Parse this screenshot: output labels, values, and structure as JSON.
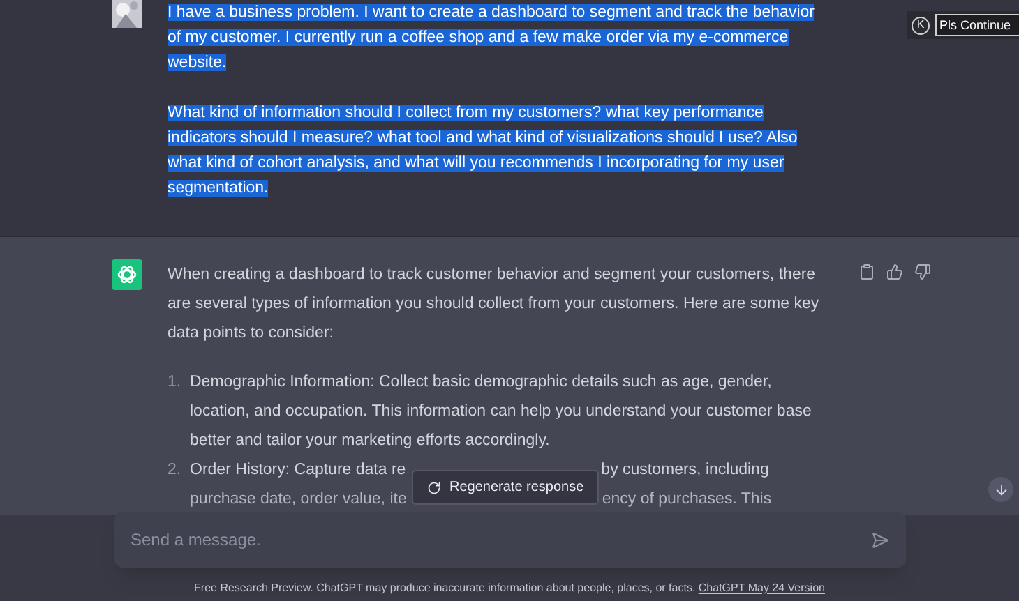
{
  "user_message": {
    "selected": true,
    "paragraphs": [
      "I have a business problem. I want to create a dashboard to segment and track the behavior of my customer. I currently run a coffee shop and a few make order via my e-commerce website.",
      "What kind of information should I collect from my customers? what key performance indicators should I measure? what tool and what kind of visualizations should I use? Also what kind of cohort analysis, and what will you recommends I incorporating for my user segmentation."
    ]
  },
  "extension": {
    "badge": "K",
    "value": "Pls Continue"
  },
  "assistant_message": {
    "paragraphs": [
      "When creating a dashboard to track customer behavior and segment your customers, there are several types of information you should collect from your customers. Here are some key data points to consider:"
    ],
    "list": [
      {
        "number": "1.",
        "text": "Demographic Information: Collect basic demographic details such as age, gender, location, and occupation. This information can help you understand your customer base better and tailor your marketing efforts accordingly."
      },
      {
        "number": "2.",
        "lines": [
          [
            "Order History: Capture data re",
            "by customers, including"
          ],
          [
            "purchase date, order value, ite",
            "ency of purchases. This"
          ]
        ]
      }
    ]
  },
  "regenerate_button": "Regenerate response",
  "composer": {
    "placeholder": "Send a message."
  },
  "footer": {
    "text": "Free Research Preview. ChatGPT may produce inaccurate information about people, places, or facts.",
    "link": "ChatGPT May 24 Version"
  }
}
